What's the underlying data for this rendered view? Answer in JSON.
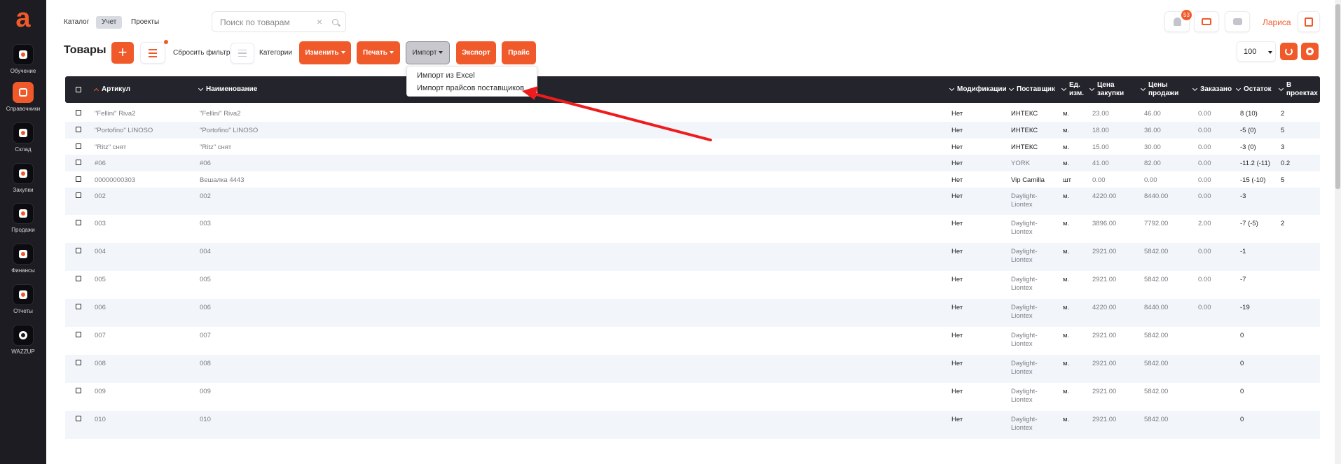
{
  "app": {
    "logo": "a"
  },
  "sidebar": {
    "items": [
      {
        "label": "Обучение"
      },
      {
        "label": "Справочники",
        "active": true
      },
      {
        "label": "Склад"
      },
      {
        "label": "Закупки"
      },
      {
        "label": "Продажи"
      },
      {
        "label": "Финансы"
      },
      {
        "label": "Отчеты"
      },
      {
        "label": "WAZZUP"
      }
    ]
  },
  "topbar": {
    "tabs": [
      "Каталог",
      "Учет",
      "Проекты"
    ],
    "active_tab": "Учет",
    "search_placeholder": "Поиск по товарам",
    "notifications_count": "53",
    "user_name": "Лариса"
  },
  "toolbar": {
    "title": "Товары",
    "add": "+",
    "reset_filter": "Сбросить фильтр",
    "categories": "Категории",
    "change": "Изменить",
    "print": "Печать",
    "import": "Импорт",
    "export": "Экспорт",
    "price": "Прайс",
    "page_size": "100"
  },
  "import_menu": {
    "items": [
      "Импорт из Excel",
      "Импорт прайсов поставщиков"
    ]
  },
  "table": {
    "columns": {
      "article": "Артикул",
      "name": "Наименование",
      "mods": "Модификации",
      "supplier": "Поставщик",
      "unit_1": "Ед.",
      "unit_2": "изм.",
      "buy_1": "Цена",
      "buy_2": "закупки",
      "sell_1": "Цены",
      "sell_2": "продажи",
      "ordered": "Заказано",
      "stock": "Остаток",
      "proj_1": "В",
      "proj_2": "проектах"
    },
    "rows": [
      {
        "article": "\"Fellini\" Riva2",
        "name": "\"Fellini\" Riva2",
        "mods": "Нет",
        "supplier": "ИНТЕКС",
        "supplier2": "",
        "unit": "м.",
        "buy": "23.00",
        "sell": "46.00",
        "ordered": "0.00",
        "stock": "8 (10)",
        "projects": "2"
      },
      {
        "article": "\"Portofino\" LINOSO",
        "name": "\"Portofino\" LINOSO",
        "mods": "Нет",
        "supplier": "ИНТЕКС",
        "supplier2": "",
        "unit": "м.",
        "buy": "18.00",
        "sell": "36.00",
        "ordered": "0.00",
        "stock": "-5 (0)",
        "projects": "5"
      },
      {
        "article": "\"Ritz\" снят",
        "name": "\"Ritz\" снят",
        "mods": "Нет",
        "supplier": "ИНТЕКС",
        "supplier2": "",
        "unit": "м.",
        "buy": "15.00",
        "sell": "30.00",
        "ordered": "0.00",
        "stock": "-3 (0)",
        "projects": "3"
      },
      {
        "article": "#06",
        "name": "#06",
        "mods": "Нет",
        "supplier": "YORK",
        "supplier2": "",
        "unit": "м.",
        "buy": "41.00",
        "sell": "82.00",
        "ordered": "0.00",
        "stock": "-11.2 (-11)",
        "projects": "0.2"
      },
      {
        "article": "00000000303",
        "name": "Вешалка 4443",
        "mods": "Нет",
        "supplier": "Vip Camilla",
        "supplier2": "",
        "unit": "шт",
        "buy": "0.00",
        "sell": "0.00",
        "ordered": "0.00",
        "stock": "-15 (-10)",
        "projects": "5"
      },
      {
        "article": "002",
        "name": "002",
        "mods": "Нет",
        "supplier": "Daylight-",
        "supplier2": "Liontex",
        "unit": "м.",
        "buy": "4220.00",
        "sell": "8440.00",
        "ordered": "0.00",
        "stock": "-3",
        "projects": ""
      },
      {
        "article": "003",
        "name": "003",
        "mods": "Нет",
        "supplier": "Daylight-",
        "supplier2": "Liontex",
        "unit": "м.",
        "buy": "3896.00",
        "sell": "7792.00",
        "ordered": "2.00",
        "stock": "-7 (-5)",
        "projects": "2"
      },
      {
        "article": "004",
        "name": "004",
        "mods": "Нет",
        "supplier": "Daylight-",
        "supplier2": "Liontex",
        "unit": "м.",
        "buy": "2921.00",
        "sell": "5842.00",
        "ordered": "0.00",
        "stock": "-1",
        "projects": ""
      },
      {
        "article": "005",
        "name": "005",
        "mods": "Нет",
        "supplier": "Daylight-",
        "supplier2": "Liontex",
        "unit": "м.",
        "buy": "2921.00",
        "sell": "5842.00",
        "ordered": "0.00",
        "stock": "-7",
        "projects": ""
      },
      {
        "article": "006",
        "name": "006",
        "mods": "Нет",
        "supplier": "Daylight-",
        "supplier2": "Liontex",
        "unit": "м.",
        "buy": "4220.00",
        "sell": "8440.00",
        "ordered": "0.00",
        "stock": "-19",
        "projects": ""
      },
      {
        "article": "007",
        "name": "007",
        "mods": "Нет",
        "supplier": "Daylight-",
        "supplier2": "Liontex",
        "unit": "м.",
        "buy": "2921.00",
        "sell": "5842.00",
        "ordered": "",
        "stock": "0",
        "projects": ""
      },
      {
        "article": "008",
        "name": "008",
        "mods": "Нет",
        "supplier": "Daylight-",
        "supplier2": "Liontex",
        "unit": "м.",
        "buy": "2921.00",
        "sell": "5842.00",
        "ordered": "",
        "stock": "0",
        "projects": ""
      },
      {
        "article": "009",
        "name": "009",
        "mods": "Нет",
        "supplier": "Daylight-",
        "supplier2": "Liontex",
        "unit": "м.",
        "buy": "2921.00",
        "sell": "5842.00",
        "ordered": "",
        "stock": "0",
        "projects": ""
      },
      {
        "article": "010",
        "name": "010",
        "mods": "Нет",
        "supplier": "Daylight-",
        "supplier2": "Liontex",
        "unit": "м.",
        "buy": "2921.00",
        "sell": "5842.00",
        "ordered": "",
        "stock": "0",
        "projects": ""
      }
    ]
  },
  "colors": {
    "accent": "#f05a2a",
    "sidebar_bg": "#1c1c22",
    "table_header_bg": "#24242c",
    "annotation_arrow": "#ee1c1c"
  }
}
